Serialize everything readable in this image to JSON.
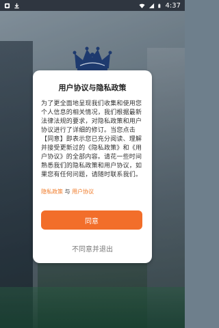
{
  "status_bar": {
    "time": "4:37",
    "icons": [
      "notification-icon",
      "download-icon",
      "wifi-icon",
      "signal-icon",
      "battery-icon"
    ]
  },
  "dialog": {
    "title": "用户协议与隐私政策",
    "body": "为了更全面地呈现我们收集和使用您个人信息的相关情况，我们根据最新法律法规的要求，对隐私政策和用户协议进行了详细的修订。当您点击【同意】即表示您已充分阅读、理解并接受更新过的《隐私政策》和《用户协议》的全部内容。请花一些时间熟悉我们的隐私政策和用户协议，如果您有任何问题，请随时联系我们。",
    "privacy_link": "隐私政策",
    "and_text": "与",
    "agreement_link": "用户协议",
    "agree_label": "同意",
    "disagree_label": "不同意并退出"
  },
  "colors": {
    "accent": "#f26e2a",
    "link": "#f07a27",
    "statusbar": "#2f3640"
  }
}
